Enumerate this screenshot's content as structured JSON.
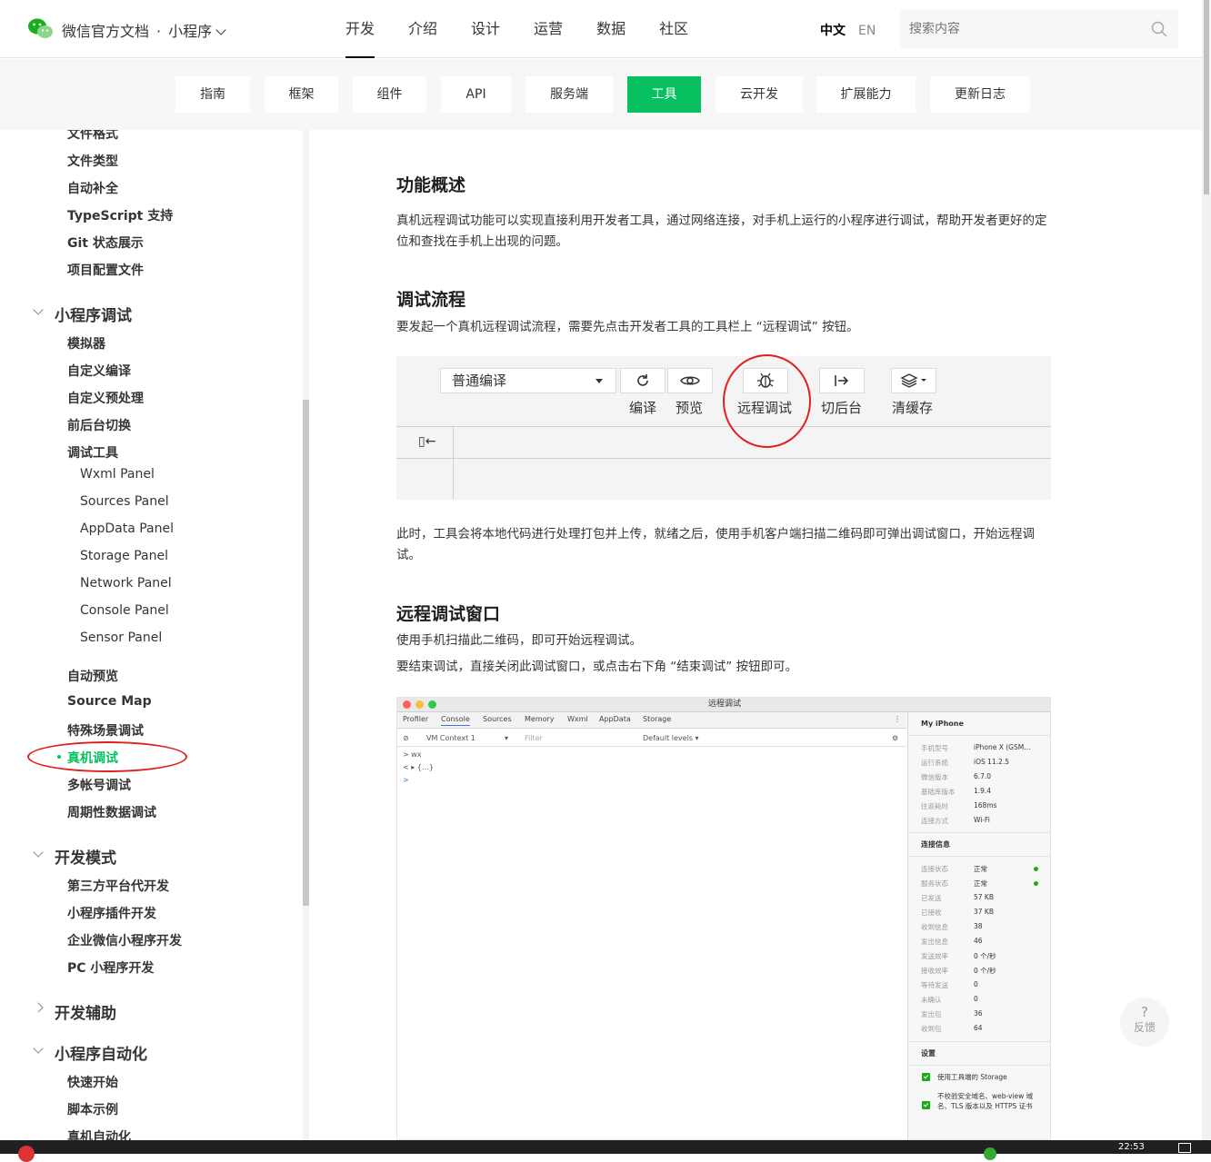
{
  "header": {
    "brand": "微信官方文档",
    "dot": "·",
    "product": "小程序",
    "nav": [
      "开发",
      "介绍",
      "设计",
      "运营",
      "数据",
      "社区"
    ],
    "lang_zh": "中文",
    "lang_en": "EN",
    "search_placeholder": "搜索内容"
  },
  "subnav": [
    "指南",
    "框架",
    "组件",
    "API",
    "服务端",
    "工具",
    "云开发",
    "扩展能力",
    "更新日志"
  ],
  "sidebar": {
    "top_items": [
      "文件格式",
      "文件类型",
      "自动补全",
      "TypeScript 支持",
      "Git 状态展示",
      "项目配置文件"
    ],
    "group_debug": "小程序调试",
    "debug_items": [
      "模拟器",
      "自定义编译",
      "自定义预处理",
      "前后台切换",
      "调试工具"
    ],
    "panels": [
      "Wxml Panel",
      "Sources Panel",
      "AppData Panel",
      "Storage Panel",
      "Network Panel",
      "Console Panel",
      "Sensor Panel"
    ],
    "debug_items2": [
      "自动预览",
      "Source Map",
      "特殊场景调试",
      "真机调试",
      "多帐号调试",
      "周期性数据调试"
    ],
    "group_dev": "开发模式",
    "dev_items": [
      "第三方平台代开发",
      "小程序插件开发",
      "企业微信小程序开发",
      "PC 小程序开发"
    ],
    "group_assist": "开发辅助",
    "group_auto": "小程序自动化",
    "auto_items": [
      "快速开始",
      "脚本示例",
      "真机自动化"
    ]
  },
  "main": {
    "h_overview": "功能概述",
    "p_overview": "真机远程调试功能可以实现直接利用开发者工具，通过网络连接，对手机上运行的小程序进行调试，帮助开发者更好的定位和查找在手机上出现的问题。",
    "h_flow": "调试流程",
    "p_flow": "要发起一个真机远程调试流程，需要先点击开发者工具的工具栏上 “远程调试” 按钮。",
    "p_after": "此时，工具会将本地代码进行处理打包并上传，就绪之后，使用手机客户端扫描二维码即可弹出调试窗口，开始远程调试。",
    "h_window": "远程调试窗口",
    "p_window1": "使用手机扫描此二维码，即可开始远程调试。",
    "p_window2": "要结束调试，直接关闭此调试窗口，或点击右下角 “结束调试” 按钮即可。"
  },
  "toolbar_fig": {
    "dropdown": "普通编译",
    "labels": [
      "编译",
      "预览",
      "远程调试",
      "切后台",
      "清缓存"
    ],
    "side_icon": "▯←"
  },
  "devtools_fig": {
    "title": "远程调试",
    "tabs": [
      "Profiler",
      "Console",
      "Sources",
      "Memory",
      "Wxml",
      "AppData",
      "Storage"
    ],
    "context": "VM Context 1",
    "filter": "Filter",
    "levels": "Default levels ▾",
    "console_lines": [
      "> wx",
      "< ▸ {…}",
      ">"
    ],
    "device_title": "My iPhone",
    "device_rows": [
      [
        "手机型号",
        "iPhone X (GSM..."
      ],
      [
        "运行系统",
        "iOS 11.2.5"
      ],
      [
        "微信版本",
        "6.7.0"
      ],
      [
        "基础库版本",
        "1.9.4"
      ],
      [
        "往返耗时",
        "168ms"
      ],
      [
        "连接方式",
        "Wi-Fi"
      ]
    ],
    "conn_title": "连接信息",
    "conn_rows": [
      [
        "连接状态",
        "正常"
      ],
      [
        "服务状态",
        "正常"
      ],
      [
        "已发送",
        "57 KB"
      ],
      [
        "已接收",
        "37 KB"
      ],
      [
        "收到信息",
        "38"
      ],
      [
        "发出信息",
        "46"
      ],
      [
        "发送效率",
        "0 个/秒"
      ],
      [
        "接收效率",
        "0 个/秒"
      ],
      [
        "等待发送",
        "0"
      ],
      [
        "未确认",
        "0"
      ],
      [
        "发出包",
        "36"
      ],
      [
        "收到包",
        "64"
      ]
    ],
    "settings_title": "设置",
    "settings": [
      "使用工具端的 Storage",
      "不校验安全域名、web-view 域名、TLS 版本以及 HTTPS 证书"
    ]
  },
  "feedback": {
    "icon": "?",
    "label": "反馈"
  },
  "taskbar": {
    "time": "22:53"
  },
  "colors": {
    "accent": "#07c160",
    "annotation": "#e02020"
  }
}
